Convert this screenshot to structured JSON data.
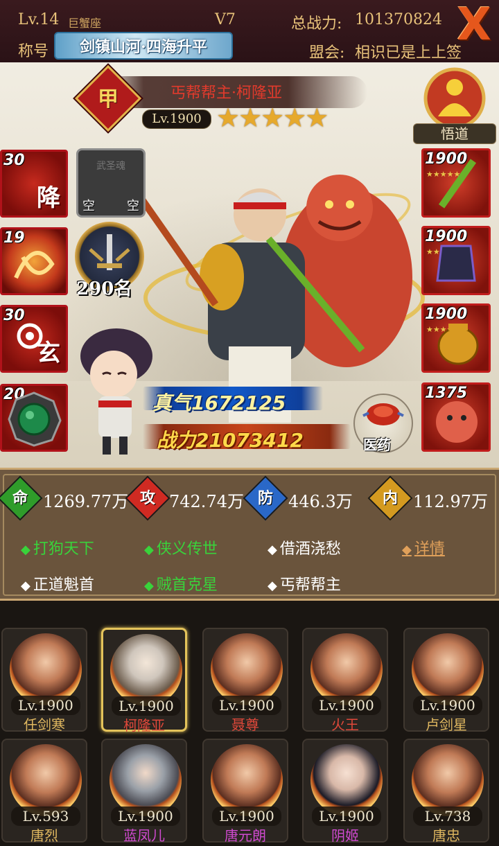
{
  "header": {
    "level": "Lv.14",
    "constellation": "巨蟹座",
    "vip": "V7",
    "total_power_label": "总战力:",
    "total_power_value": "101370824",
    "title_label": "称号",
    "title_value": "剑镇山河·四海升平",
    "guild_label": "盟会:",
    "guild_value": "相识已是上上签",
    "close_symbol": "X"
  },
  "hero": {
    "rank_badge": "甲",
    "name": "丐帮帮主·柯隆亚",
    "level": "Lv.1900",
    "stars": 5,
    "stars_glyphs": "★★★★★",
    "rank": "290名",
    "zhenqi": "真气1672125",
    "zhanli": "战力21073412",
    "medicine_label": "医药",
    "wudao_label": "悟道",
    "empty_slot": {
      "title": "武圣魂",
      "left": "空",
      "right": "空"
    }
  },
  "skills": [
    {
      "num": "30",
      "char": "降",
      "icon": "fist-flame-icon"
    },
    {
      "num": "19",
      "char": "",
      "icon": "dragon-swirl-icon"
    },
    {
      "num": "30",
      "char": "玄",
      "icon": "palm-orb-icon"
    },
    {
      "num": "20",
      "char": "",
      "icon": "jade-ring-icon"
    }
  ],
  "equipment": [
    {
      "num": "1900",
      "icon": "bamboo-staff-icon",
      "stars": "★★★★★"
    },
    {
      "num": "1900",
      "icon": "armor-icon",
      "stars": "★★★★★"
    },
    {
      "num": "1900",
      "icon": "gold-pot-icon",
      "stars": "★★★★★"
    },
    {
      "num": "1375",
      "icon": "red-lion-icon",
      "stars": ""
    }
  ],
  "stats": [
    {
      "label": "命",
      "value": "1269.77万",
      "color": "#2f9c2a"
    },
    {
      "label": "攻",
      "value": "742.74万",
      "color": "#d02a22"
    },
    {
      "label": "防",
      "value": "446.3万",
      "color": "#2a68c8"
    },
    {
      "label": "内",
      "value": "112.97万",
      "color": "#d49a20"
    }
  ],
  "traits": [
    {
      "label": "打狗天下",
      "active": true
    },
    {
      "label": "侠义传世",
      "active": true
    },
    {
      "label": "借酒浇愁",
      "active": false
    },
    {
      "label": "详情",
      "link": true
    },
    {
      "label": "正道魁首",
      "active": false
    },
    {
      "label": "贼首克星",
      "active": true
    },
    {
      "label": "丐帮帮主",
      "active": false
    }
  ],
  "roster": [
    {
      "level": "Lv.1900",
      "name": "任剑寒",
      "name_color": "#e0b860",
      "active": false
    },
    {
      "level": "Lv.1900",
      "name": "柯隆亚",
      "name_color": "#e0483a",
      "active": true
    },
    {
      "level": "Lv.1900",
      "name": "聂尊",
      "name_color": "#e0483a",
      "active": false
    },
    {
      "level": "Lv.1900",
      "name": "火王",
      "name_color": "#e0483a",
      "active": false
    },
    {
      "level": "Lv.1900",
      "name": "卢剑星",
      "name_color": "#e0b860",
      "active": false
    },
    {
      "level": "Lv.593",
      "name": "唐烈",
      "name_color": "#e0b860",
      "active": false
    },
    {
      "level": "Lv.1900",
      "name": "蓝凤儿",
      "name_color": "#d04ad0",
      "active": false
    },
    {
      "level": "Lv.1900",
      "name": "唐元朗",
      "name_color": "#d04ad0",
      "active": false
    },
    {
      "level": "Lv.1900",
      "name": "阴姬",
      "name_color": "#d04ad0",
      "active": false
    },
    {
      "level": "Lv.738",
      "name": "唐忠",
      "name_color": "#e0b860",
      "active": false
    }
  ]
}
